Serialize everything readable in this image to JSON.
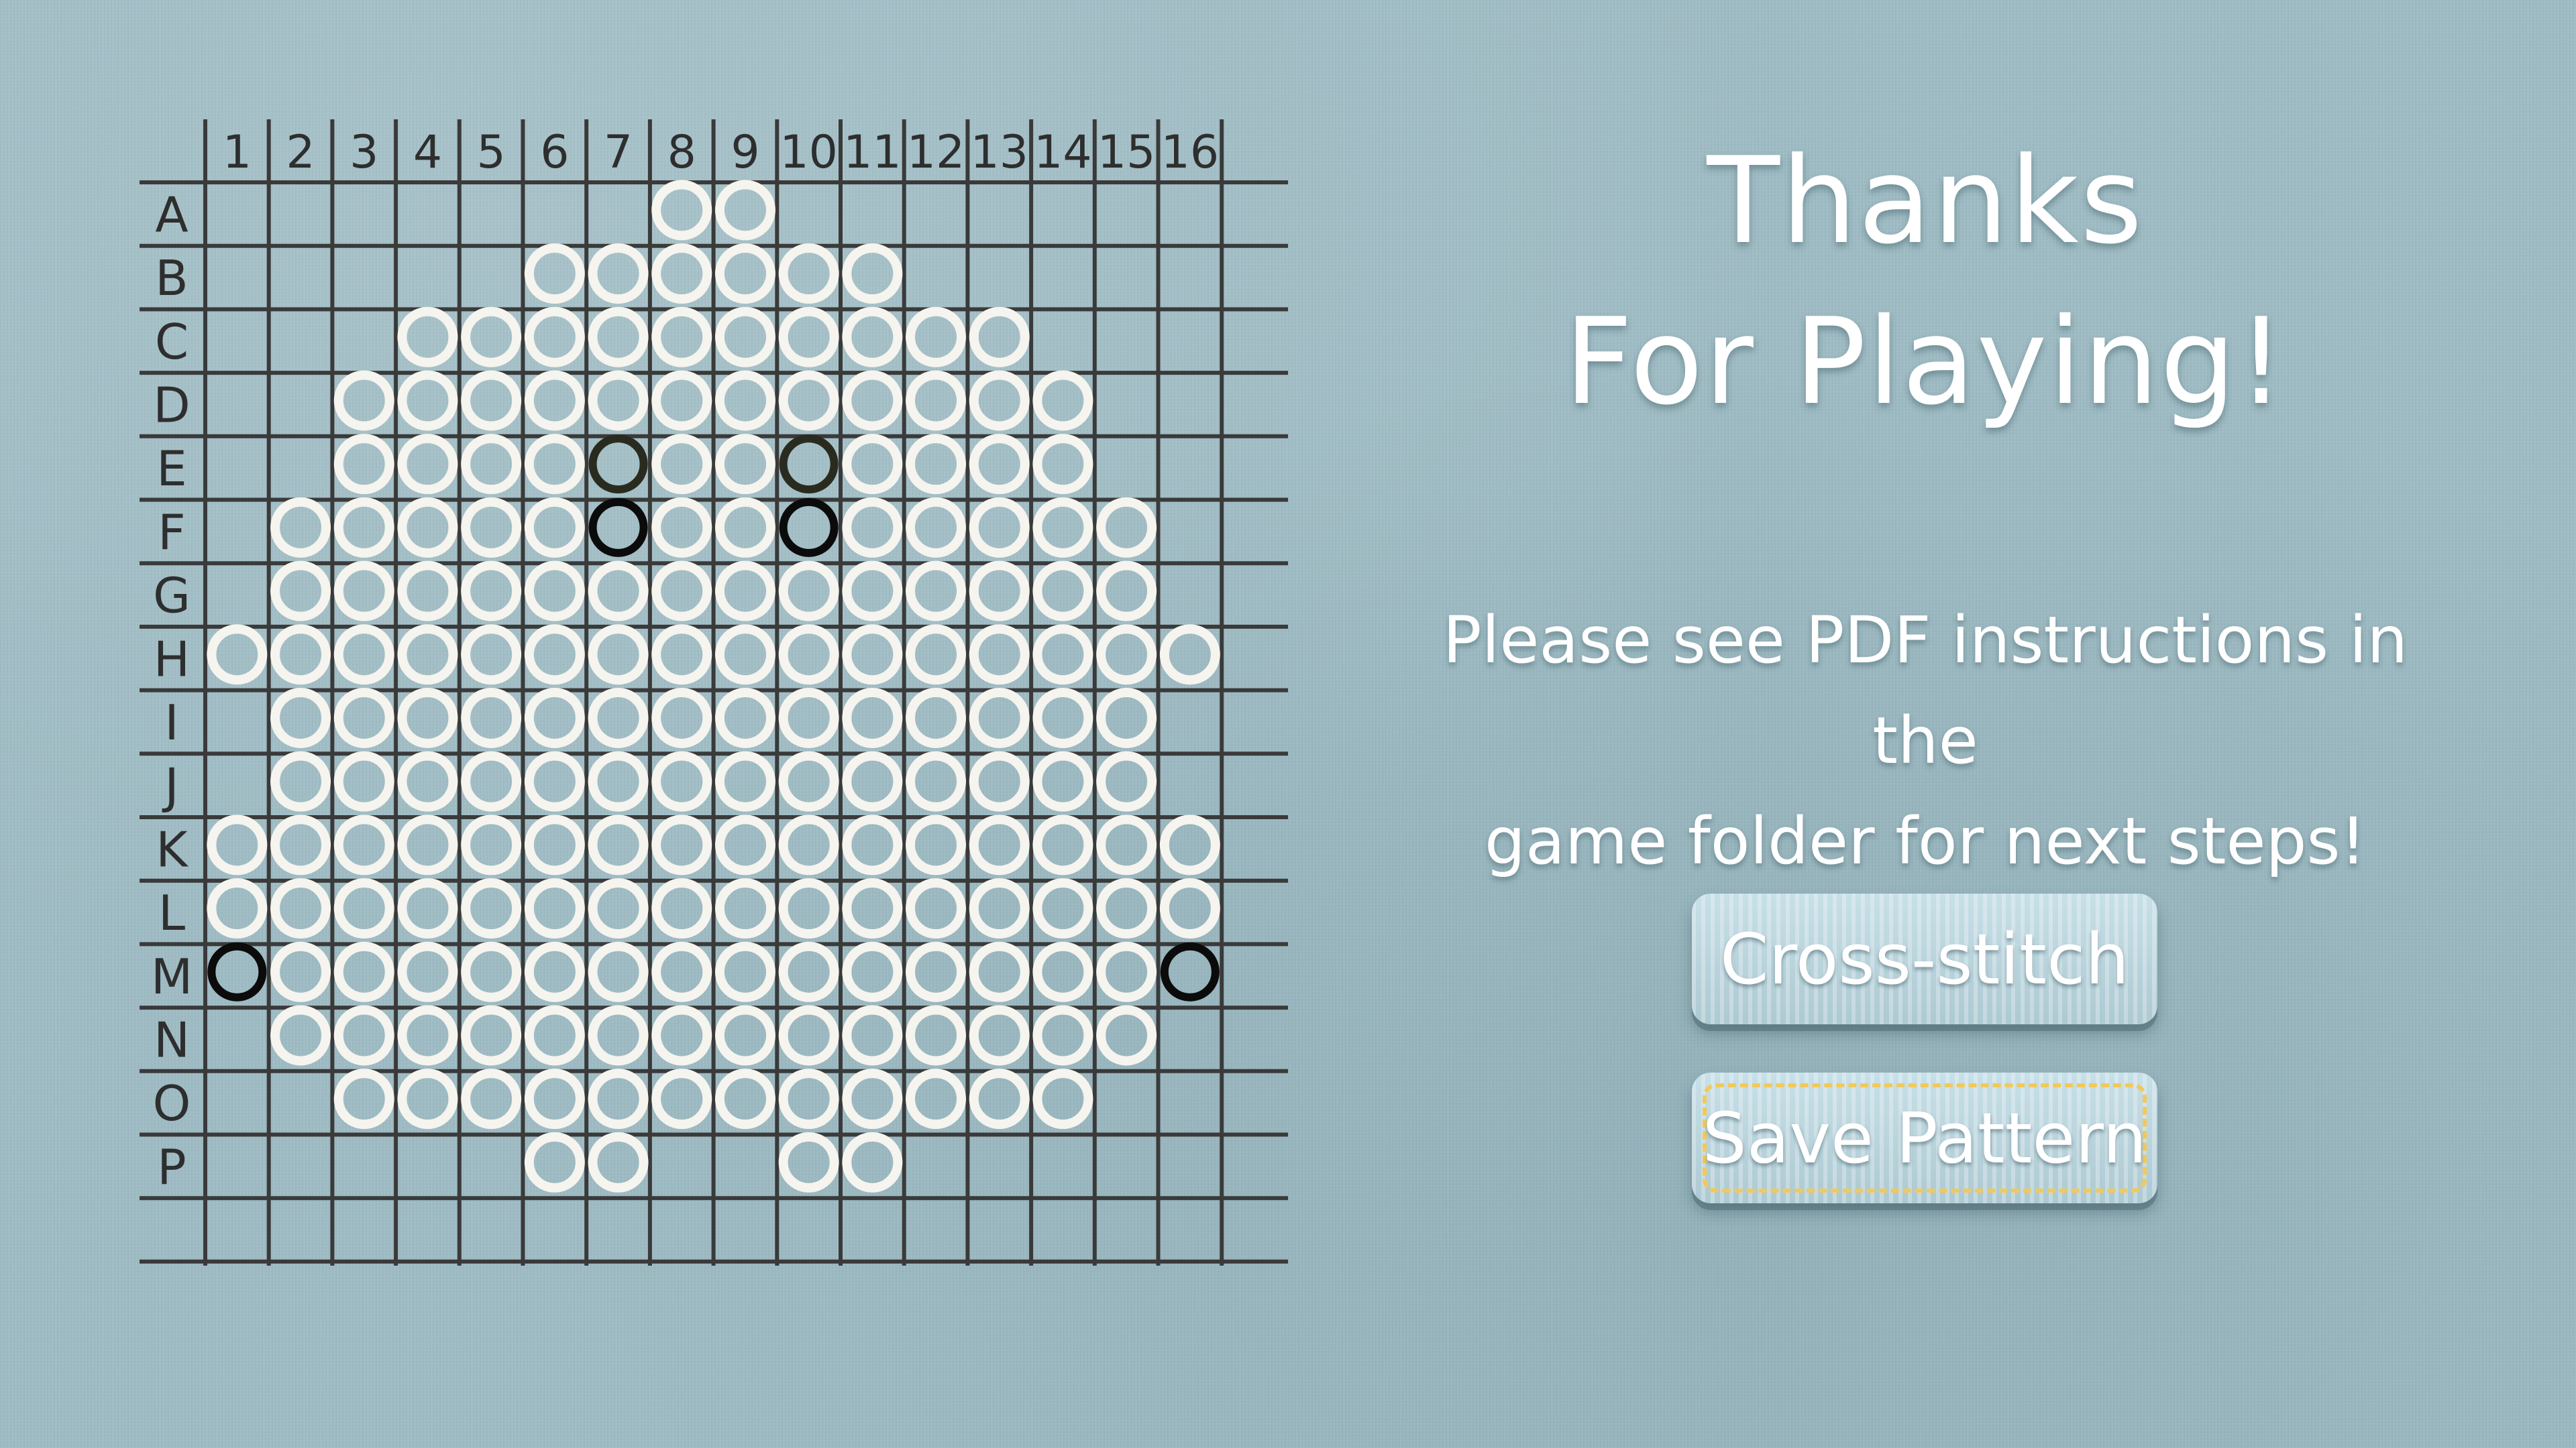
{
  "screen": {
    "title_lines": [
      "Thanks",
      "For Playing!"
    ],
    "instructions_lines": [
      "Please see PDF instructions in the",
      "game folder for next steps!"
    ]
  },
  "buttons": {
    "cross_stitch": "Cross-stitch",
    "save_pattern": "Save Pattern"
  },
  "grid": {
    "column_labels": [
      "1",
      "2",
      "3",
      "4",
      "5",
      "6",
      "7",
      "8",
      "9",
      "10",
      "11",
      "12",
      "13",
      "14",
      "15",
      "16"
    ],
    "row_labels": [
      "A",
      "B",
      "C",
      "D",
      "E",
      "F",
      "G",
      "H",
      "I",
      "J",
      "K",
      "L",
      "M",
      "N",
      "O",
      "P"
    ],
    "pattern": [
      "0000000110000000",
      "0000011111100000",
      "0001111111111000",
      "0011111111111100",
      "0011112112111100",
      "0111113113111110",
      "0111111111111110",
      "1111111111111111",
      "0111111111111110",
      "0111111111111110",
      "1111111111111111",
      "1111111111111111",
      "3111111111111113",
      "0111111111111110",
      "0011111111111100",
      "0000011001100000"
    ],
    "stitch_legend": {
      "0": "empty",
      "1": "white stitch",
      "2": "dark olive stitch",
      "3": "black stitch"
    },
    "colors": {
      "white_stitch": "#f5f4ee",
      "dark_olive_stitch": "#2a2b1f",
      "black_stitch": "#0b0b0b",
      "grid_line": "#3a3a3a",
      "label": "#2e2e2e"
    }
  }
}
